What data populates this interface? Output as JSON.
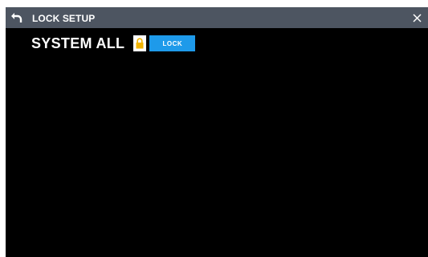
{
  "header": {
    "title": "LOCK SETUP",
    "back_icon": "back-arrow-icon",
    "close_icon": "close-icon"
  },
  "lock_row": {
    "label": "SYSTEM ALL",
    "icon": "padlock-icon",
    "button_label": "LOCK",
    "state": "unlocked"
  },
  "colors": {
    "background": "#000000",
    "titlebar": "#4d5561",
    "accent": "#1e9aea",
    "lock_icon": "#f2b400"
  }
}
